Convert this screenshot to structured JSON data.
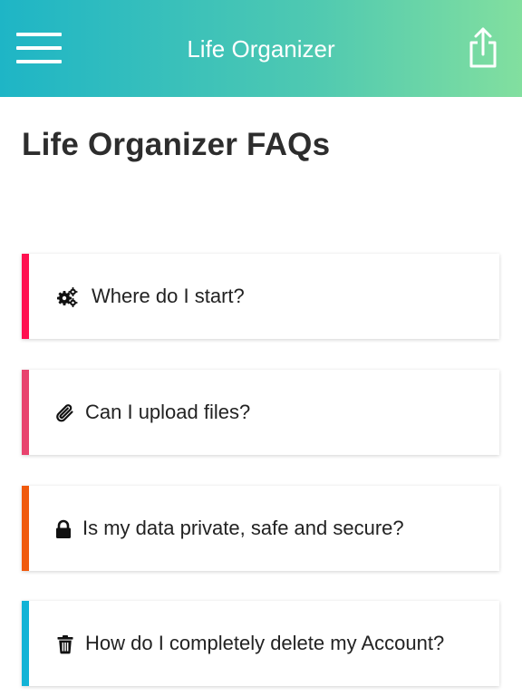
{
  "header": {
    "title": "Life Organizer",
    "menu_icon": "hamburger-menu-icon",
    "share_icon": "share-icon",
    "gradient_start": "#1eb5c6",
    "gradient_end": "#82df9f"
  },
  "page": {
    "title": "Life Organizer FAQs"
  },
  "faqs": [
    {
      "question": "Where do I start?",
      "icon": "gears-icon",
      "accent": "#ff1150"
    },
    {
      "question": "Can I upload files?",
      "icon": "paperclip-icon",
      "accent": "#e8436e"
    },
    {
      "question": "Is my data private, safe and secure?",
      "icon": "lock-icon",
      "accent": "#f05a0c"
    },
    {
      "question": "How do I completely delete my Account?",
      "icon": "trash-icon",
      "accent": "#12b3d6"
    }
  ]
}
